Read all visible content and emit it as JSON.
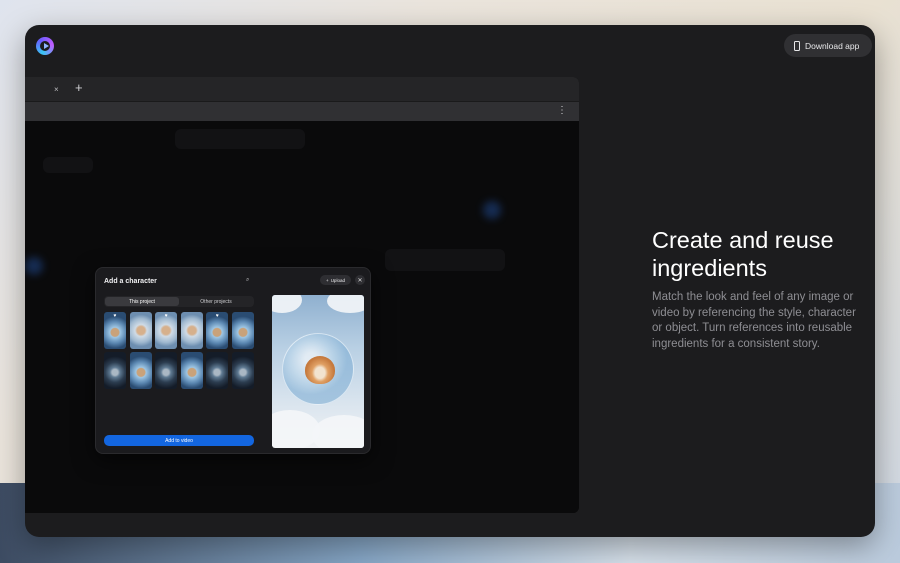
{
  "app": {
    "logo_icon": "app-logo-icon",
    "download_label": "Download app",
    "download_icon": "phone-icon"
  },
  "browser": {
    "tab_close_icon": "close-icon",
    "tab_close_glyph": "×",
    "new_tab_glyph": "+",
    "more_glyph": "⋮"
  },
  "modal": {
    "title": "Add a character",
    "search_glyph": "⌕",
    "upload_label": "Upload",
    "upload_glyph": "+",
    "close_glyph": "✕",
    "tabs": [
      {
        "label": "This project",
        "active": true
      },
      {
        "label": "Other projects",
        "active": false
      }
    ],
    "add_button_label": "Add to video"
  },
  "feature": {
    "headline": "Create and reuse ingredients",
    "description": "Match the look and feel of any image or video by referencing the style, character or object. Turn references into reusable ingredients for a consistent story."
  },
  "colors": {
    "accent": "#1366e0",
    "window_bg": "#1c1c1e"
  }
}
